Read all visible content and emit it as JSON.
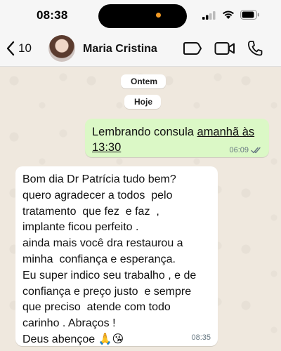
{
  "status_bar": {
    "time": "08:38"
  },
  "header": {
    "back_count": "10",
    "contact_name": "Maria Cristina",
    "icons": [
      "chevron-left-icon",
      "label-icon",
      "video-camera-icon",
      "phone-icon"
    ]
  },
  "date_chips": {
    "yesterday": "Ontem",
    "today": "Hoje"
  },
  "messages": [
    {
      "direction": "outgoing",
      "text_before_link": "Lembrando consula ",
      "link_text": "amanhã às 13:30",
      "time": "06:09",
      "status": "read"
    },
    {
      "direction": "incoming",
      "text": "Bom dia Dr Patrícia tudo bem?\nquero agradecer a todos  pelo\ntratamento  que fez  e faz  ,\nimplante ficou perfeito .\nainda mais você dra restaurou a\nminha  confiança e esperança.\nEu super indico seu trabalho , e de\nconfiança e preço justo  e sempre\nque preciso  atende com todo\ncarinho . Abraços !\nDeus abençoe 🙏😘",
      "time": "08:35"
    }
  ],
  "colors": {
    "outgoing_bubble": "#dbf8c6",
    "incoming_bubble": "#ffffff",
    "read_ticks": "#53bdeb",
    "wallpaper": "#efe8de"
  }
}
